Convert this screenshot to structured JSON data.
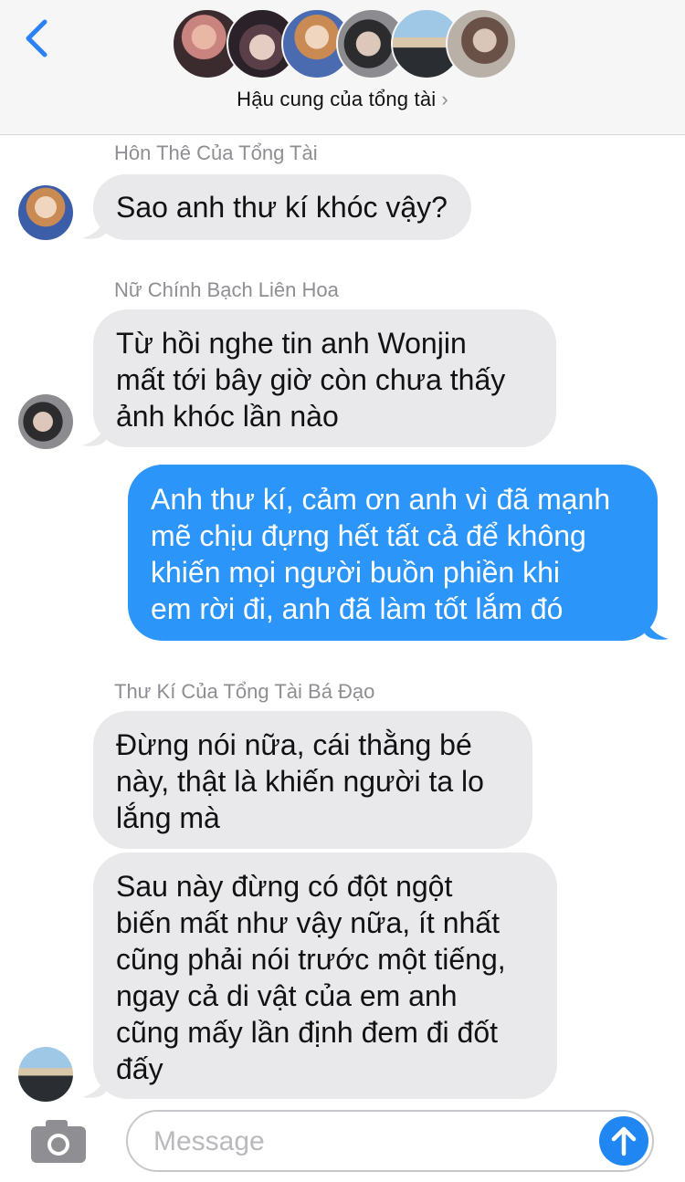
{
  "header": {
    "back_icon": "chevron-left-icon",
    "group_title": "Hậu cung của tổng tài",
    "title_chevron": "›",
    "accent": "#2b95f9",
    "avatars": [
      {
        "name": "member-1",
        "colors": [
          "#3b2b2e",
          "#c9847f"
        ]
      },
      {
        "name": "member-2",
        "colors": [
          "#2a2228",
          "#e6cdc4"
        ]
      },
      {
        "name": "member-3",
        "colors": [
          "#c98b53",
          "#4a6bb0"
        ]
      },
      {
        "name": "member-4",
        "colors": [
          "#2c2c2e",
          "#dcc7ba"
        ]
      },
      {
        "name": "member-5",
        "colors": [
          "#7db0d6",
          "#2a2e33"
        ]
      },
      {
        "name": "member-6",
        "colors": [
          "#6a5148",
          "#d9c6b9"
        ]
      }
    ]
  },
  "messages": [
    {
      "sender": "Hôn Thê Của Tổng Tài",
      "text": "Sao anh thư kí khóc vậy?"
    },
    {
      "sender": "Nữ Chính Bạch Liên Hoa",
      "lines": [
        "Từ hồi nghe tin anh Wonjin",
        "mất tới bây giờ còn chưa thấy",
        "ảnh khóc lần nào"
      ]
    },
    {
      "outgoing": true,
      "lines": [
        "Anh thư kí, cảm ơn anh vì đã mạnh",
        "mẽ chịu đựng hết tất cả để không",
        "khiến mọi người buồn phiền khi",
        "em rời đi, anh đã làm tốt lắm đó"
      ]
    },
    {
      "sender": "Thư Kí Của Tổng Tài Bá Đạo",
      "lines": [
        "Đừng nói nữa, cái thằng bé",
        "này, thật là khiến người ta lo",
        "lắng mà"
      ]
    },
    {
      "lines": [
        "Sau này đừng có đột ngột",
        "biến mất như vậy nữa, ít nhất",
        "cũng phải nói trước một tiếng,",
        "ngay cả di vật của em anh",
        "cũng mấy lần định đem đi đốt",
        "đấy"
      ]
    }
  ],
  "composer": {
    "placeholder": "Message",
    "camera_icon": "camera-icon",
    "send_icon": "arrow-up-icon"
  }
}
